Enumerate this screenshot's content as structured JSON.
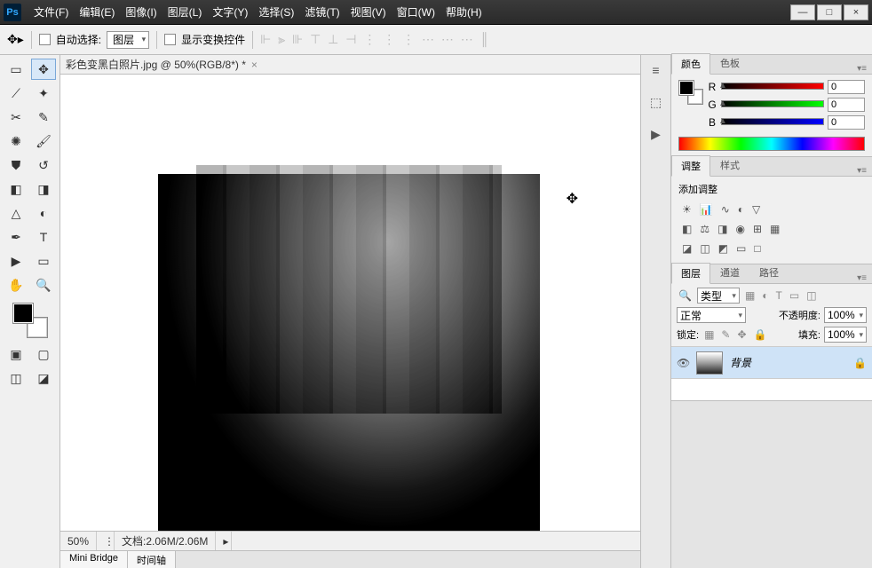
{
  "app": {
    "logo": "Ps"
  },
  "menu": [
    "文件(F)",
    "编辑(E)",
    "图像(I)",
    "图层(L)",
    "文字(Y)",
    "选择(S)",
    "滤镜(T)",
    "视图(V)",
    "窗口(W)",
    "帮助(H)"
  ],
  "winctrl": {
    "min": "—",
    "max": "□",
    "close": "×"
  },
  "options": {
    "auto_select": "自动选择:",
    "layer_dropdown": "图层",
    "show_transform": "显示变换控件"
  },
  "document": {
    "tab": "彩色变黑白照片.jpg @ 50%(RGB/8*) *",
    "close": "×",
    "zoom": "50%",
    "docinfo": "文档:2.06M/2.06M"
  },
  "minitabs": [
    "Mini Bridge",
    "时间轴"
  ],
  "color_panel": {
    "tabs": [
      "颜色",
      "色板"
    ],
    "r": {
      "label": "R",
      "value": "0"
    },
    "g": {
      "label": "G",
      "value": "0"
    },
    "b": {
      "label": "B",
      "value": "0"
    }
  },
  "adjust_panel": {
    "tabs": [
      "调整",
      "样式"
    ],
    "title": "添加调整"
  },
  "layers_panel": {
    "tabs": [
      "图层",
      "通道",
      "路径"
    ],
    "kind_label": "类型",
    "blend": "正常",
    "opacity_label": "不透明度:",
    "opacity_value": "100%",
    "lock_label": "锁定:",
    "fill_label": "填充:",
    "fill_value": "100%",
    "layer0": {
      "name": "背景"
    }
  }
}
